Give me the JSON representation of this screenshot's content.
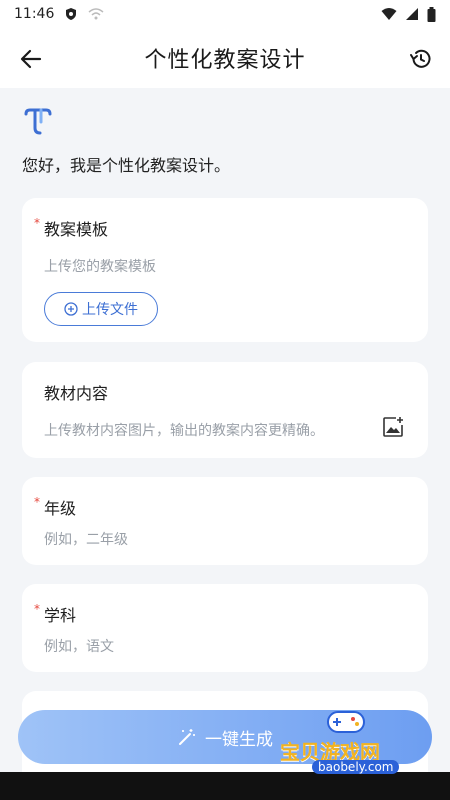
{
  "status_bar": {
    "time": "11:46"
  },
  "header": {
    "title": "个性化教案设计"
  },
  "greeting": "您好，我是个性化教案设计。",
  "cards": [
    {
      "label": "教案模板",
      "required": "*",
      "hint": "上传您的教案模板",
      "upload_label": "上传文件"
    },
    {
      "label": "教材内容",
      "hint": "上传教材内容图片，输出的教案内容更精确。"
    },
    {
      "label": "年级",
      "required": "*",
      "hint": "例如，二年级"
    },
    {
      "label": "学科",
      "required": "*",
      "hint": "例如，语文"
    }
  ],
  "generate_button": {
    "label": "一键生成"
  },
  "watermark": {
    "text_main": "宝贝游戏网",
    "text_sub": "baobely.com"
  },
  "colors": {
    "accent": "#3d6fd3",
    "required": "#e5483e",
    "button_start": "#9fc3f7",
    "button_end": "#6d9ef1"
  }
}
